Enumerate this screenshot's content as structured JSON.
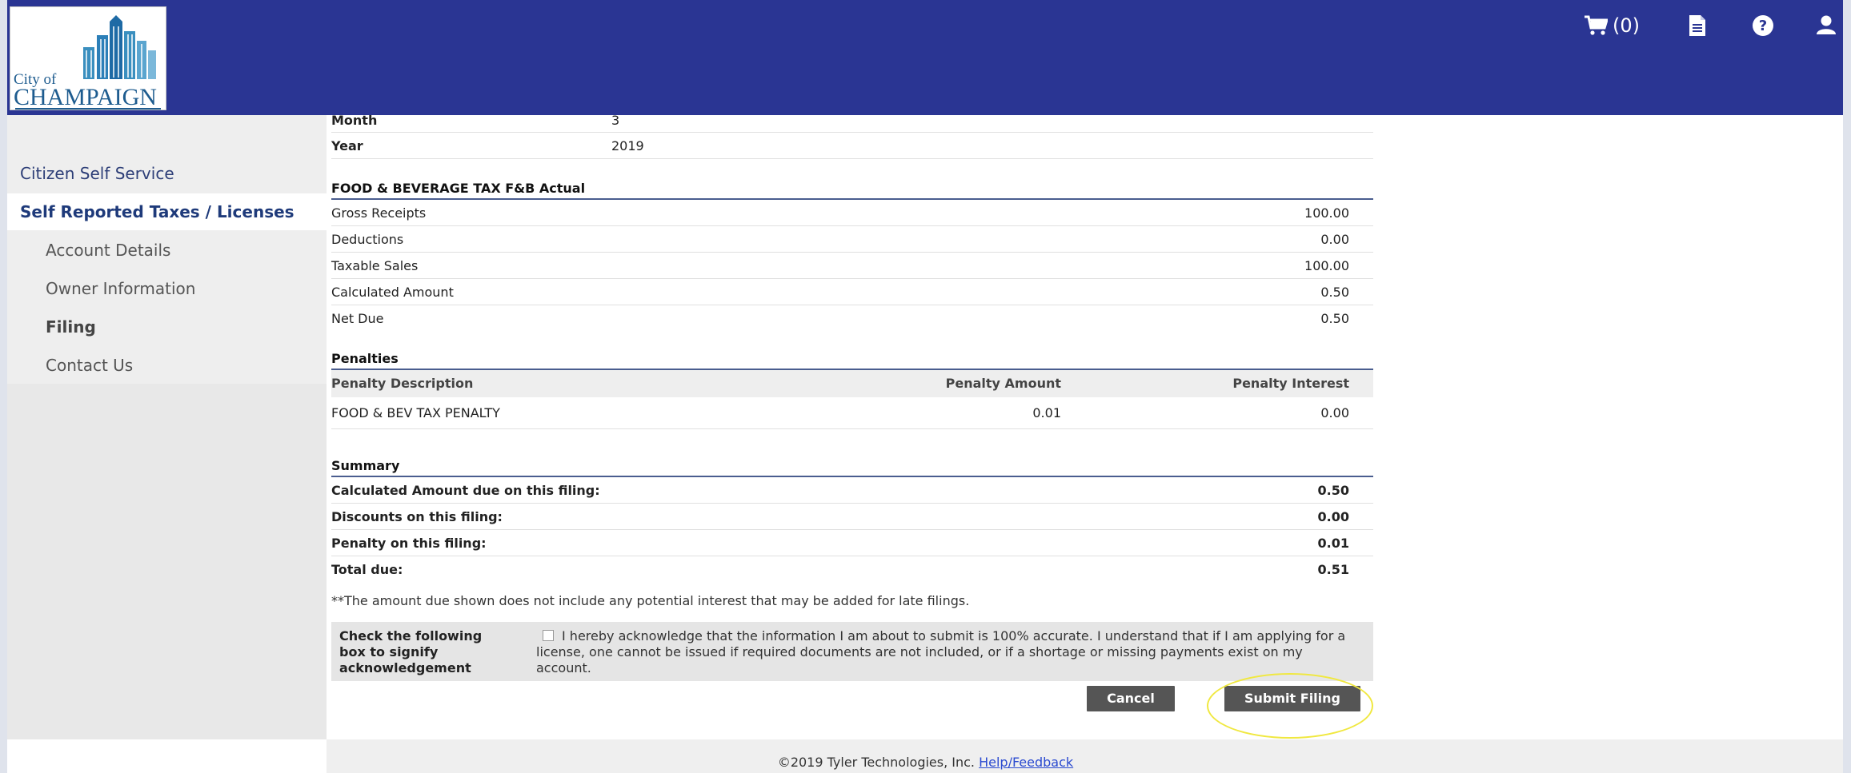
{
  "header": {
    "logo_text_small": "City of",
    "logo_text_large": "CHAMPAIGN",
    "cart_count": "(0)",
    "icons": [
      "cart-icon",
      "document-icon",
      "help-icon",
      "user-icon"
    ]
  },
  "sidebar": {
    "items": [
      {
        "label": "Citizen Self Service"
      },
      {
        "label": "Self Reported Taxes / Licenses"
      },
      {
        "label": "Account Details"
      },
      {
        "label": "Owner Information"
      },
      {
        "label": "Filing"
      },
      {
        "label": "Contact Us"
      }
    ]
  },
  "period": {
    "month_label": "Month",
    "month_value": "3",
    "year_label": "Year",
    "year_value": "2019"
  },
  "tax": {
    "title": "FOOD & BEVERAGE TAX  F&B Actual",
    "rows": [
      {
        "label": "Gross Receipts",
        "value": "100.00"
      },
      {
        "label": "Deductions",
        "value": "0.00"
      },
      {
        "label": "Taxable Sales",
        "value": "100.00"
      },
      {
        "label": "Calculated Amount",
        "value": "0.50"
      },
      {
        "label": "Net Due",
        "value": "0.50"
      }
    ]
  },
  "penalties": {
    "title": "Penalties",
    "col_desc": "Penalty Description",
    "col_amount": "Penalty Amount",
    "col_interest": "Penalty Interest",
    "rows": [
      {
        "desc": "FOOD & BEV TAX PENALTY",
        "amount": "0.01",
        "interest": "0.00"
      }
    ]
  },
  "summary": {
    "title": "Summary",
    "rows": [
      {
        "label": "Calculated Amount due on this filing:",
        "value": "0.50"
      },
      {
        "label": "Discounts on this filing:",
        "value": "0.00"
      },
      {
        "label": "Penalty on this filing:",
        "value": "0.01"
      },
      {
        "label": "Total due:",
        "value": "0.51"
      }
    ],
    "note": "**The amount due shown does not include any potential interest that may be added for late filings."
  },
  "acknowledgement": {
    "label": "Check the following box to signify acknowledgement",
    "text": "I hereby acknowledge that the information I am about to submit is 100% accurate. I understand that if I am applying for a license, one cannot be issued if required documents are not included, or if a shortage or missing payments exist on my account.",
    "checked": false
  },
  "buttons": {
    "cancel": "Cancel",
    "submit": "Submit Filing"
  },
  "footer": {
    "copyright": "©2019 Tyler Technologies, Inc.",
    "link": "Help/Feedback"
  },
  "colors": {
    "header": "#2a3593",
    "button": "#555555",
    "highlight": "#f0e840"
  }
}
